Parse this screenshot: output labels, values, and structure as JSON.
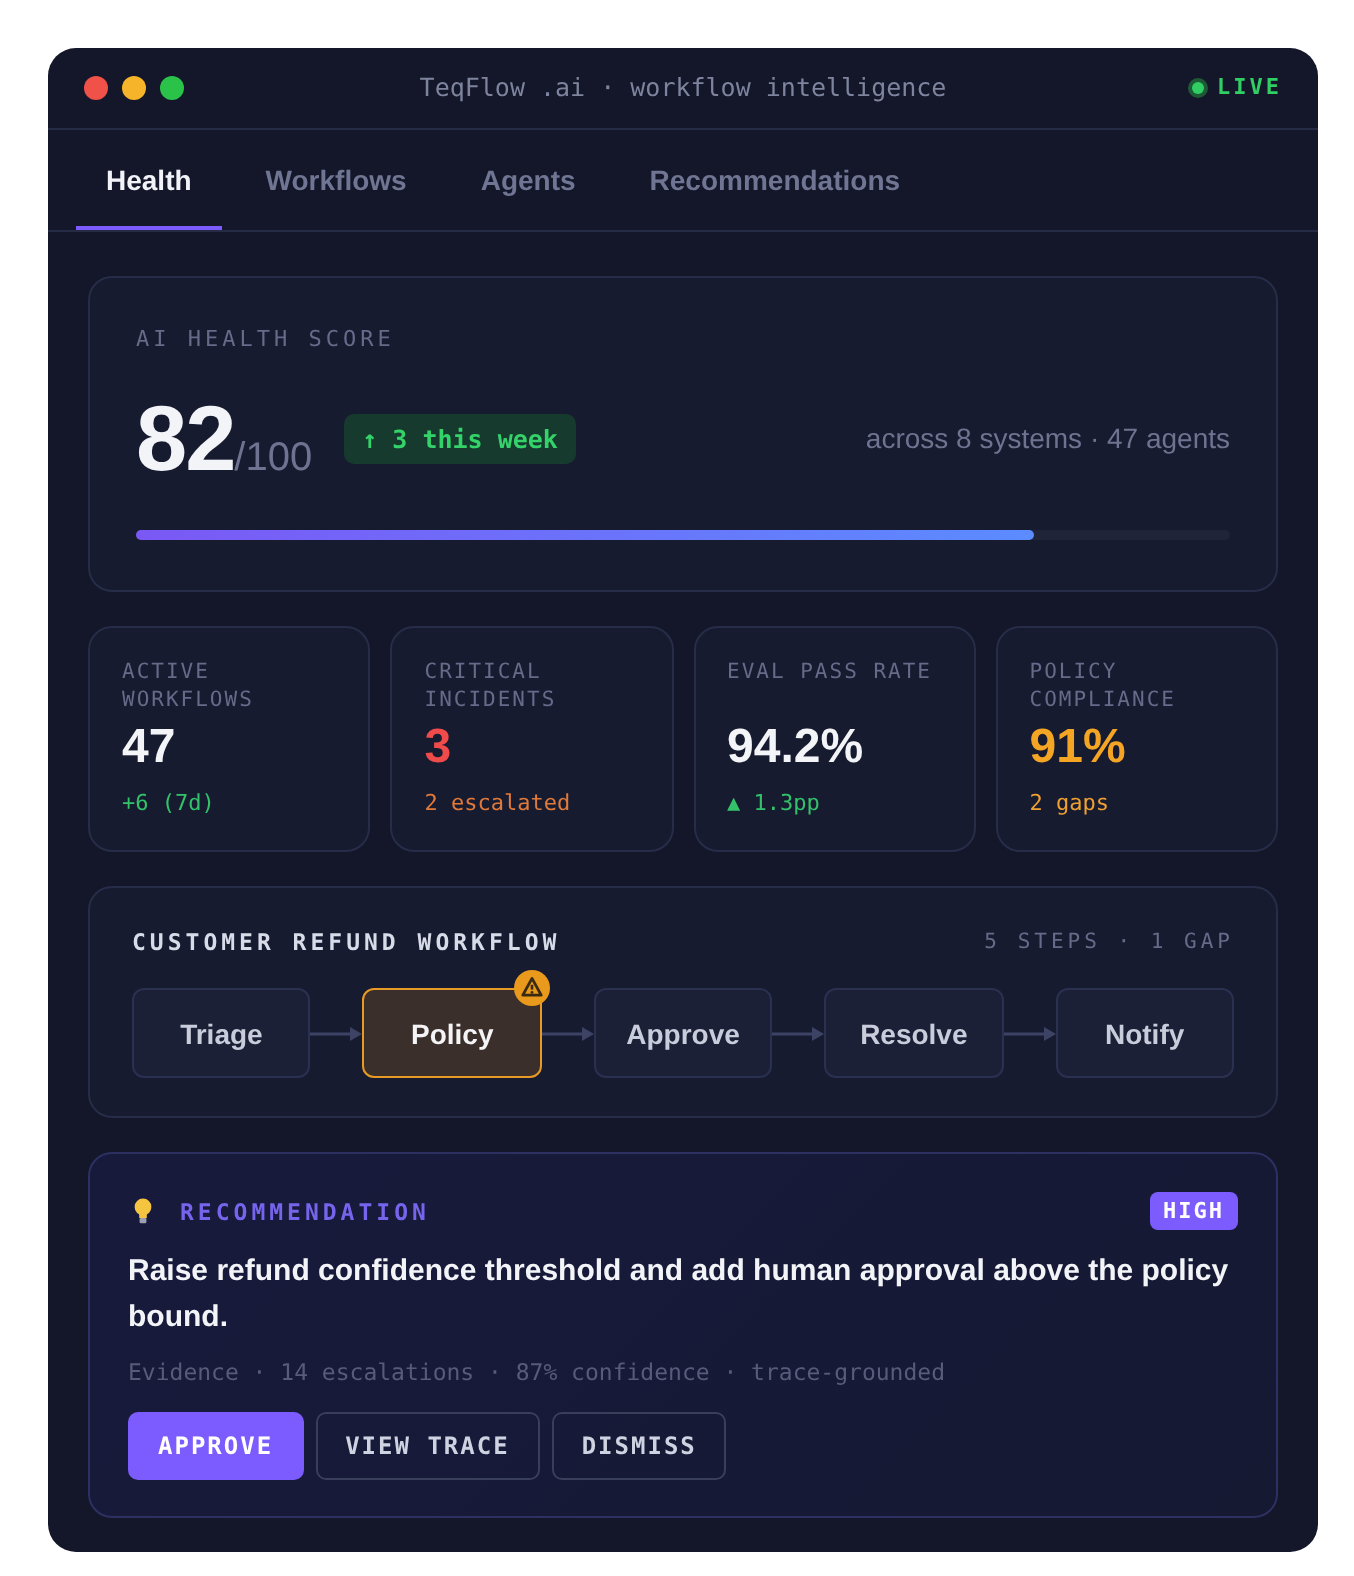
{
  "window": {
    "title": "TeqFlow .ai · workflow intelligence",
    "status": "LIVE"
  },
  "tabs": [
    {
      "label": "Health",
      "selected": true
    },
    {
      "label": "Workflows",
      "selected": false
    },
    {
      "label": "Agents",
      "selected": false
    },
    {
      "label": "Recommendations",
      "selected": false
    }
  ],
  "health": {
    "label": "AI HEALTH SCORE",
    "score": "82",
    "scale": "/100",
    "delta": "↑ 3 this week",
    "summary": "across 8 systems · 47 agents",
    "level": 0.82
  },
  "stats": [
    {
      "label": "ACTIVE WORKFLOWS",
      "value": "47",
      "note": "+6 (7d)",
      "kind": "neutral"
    },
    {
      "label": "CRITICAL INCIDENTS",
      "value": "3",
      "note": "2 escalated",
      "kind": "critical"
    },
    {
      "label": "EVAL PASS RATE",
      "value": "94.2%",
      "note": "▲ 1.3pp",
      "kind": "neutral"
    },
    {
      "label": "POLICY COMPLIANCE",
      "value": "91%",
      "note": "2 gaps",
      "kind": "warning"
    }
  ],
  "workflow": {
    "title": "CUSTOMER REFUND WORKFLOW",
    "summary": "5 STEPS · 1 GAP",
    "steps": [
      {
        "label": "Triage",
        "gap": false
      },
      {
        "label": "Policy",
        "gap": true
      },
      {
        "label": "Approve",
        "gap": false
      },
      {
        "label": "Resolve",
        "gap": false
      },
      {
        "label": "Notify",
        "gap": false
      }
    ]
  },
  "recommendation": {
    "label": "RECOMMENDATION",
    "priority": "HIGH",
    "text": "Raise refund confidence threshold and add human approval above the policy bound.",
    "evidence": "Evidence · 14 escalations · 87% confidence · trace-grounded",
    "actions": [
      {
        "label": "APPROVE",
        "kind": "primary"
      },
      {
        "label": "VIEW TRACE",
        "kind": "secondary"
      },
      {
        "label": "DISMISS",
        "kind": "secondary"
      }
    ]
  }
}
